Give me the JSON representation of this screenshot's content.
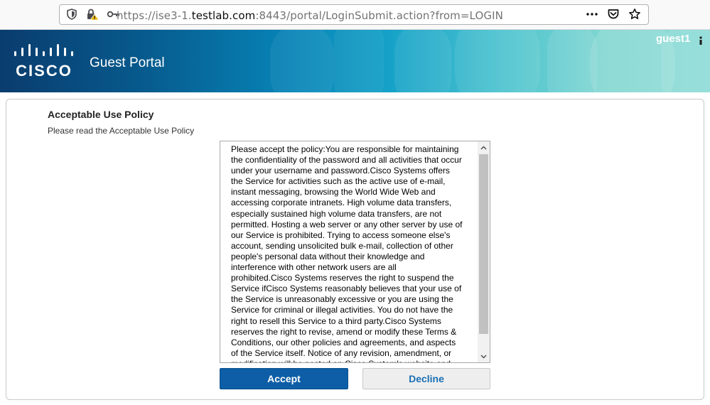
{
  "browser": {
    "url_prefix": "https://ise3-1.",
    "url_host": "testlab.com",
    "url_suffix": ":8443/portal/LoginSubmit.action?from=LOGIN",
    "icons": [
      "shield-icon",
      "lock-warning-icon",
      "key-icon",
      "more-icon",
      "pocket-icon",
      "star-icon"
    ]
  },
  "header": {
    "logo_text": "CISCO",
    "title": "Guest Portal",
    "user": "guest1"
  },
  "aup": {
    "title": "Acceptable Use Policy",
    "subtitle": "Please read the Acceptable Use Policy",
    "text": "Please accept the policy:You are responsible for maintaining\nthe confidentiality of the password and all activities that occur\nunder your username and password.Cisco Systems offers\nthe Service for activities such as the active use of e-mail,\ninstant messaging, browsing the World Wide Web and\naccessing corporate intranets. High volume data transfers,\nespecially sustained high volume data transfers, are not\npermitted. Hosting a web server or any other server by use of\nour Service is prohibited. Trying to access someone else's\naccount, sending unsolicited bulk e-mail, collection of other\npeople's personal data without their knowledge and\ninterference with other network users are all\nprohibited.Cisco Systems reserves the right to suspend the\nService ifCisco Systems reasonably believes that your use of\nthe Service is unreasonably excessive or you are using the\nService for criminal or illegal activities. You do not have the\nright to resell this Service to a third party.Cisco Systems\nreserves the right to revise, amend or modify these Terms &\nConditions, our other policies and agreements, and aspects\nof the Service itself. Notice of any revision, amendment, or\nmodification will be posted on Cisco System's website and",
    "accept_label": "Accept",
    "decline_label": "Decline"
  },
  "colors": {
    "accept_bg": "#0d5ea6",
    "decline_text": "#1a6fb5",
    "banner_dark": "#0a3c6e",
    "banner_light": "#8ddcd7"
  }
}
